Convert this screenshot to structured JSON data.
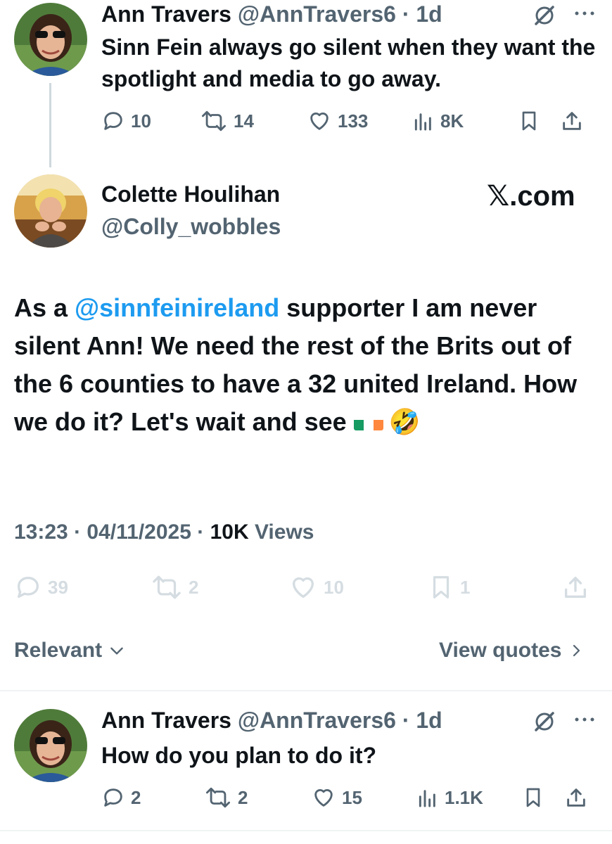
{
  "parent_tweet": {
    "author_name": "Ann Travers",
    "handle_time": "@AnnTravers6 · 1d",
    "text": "Sinn Fein always go silent when they want the spotlight and media to go away.",
    "reply_count": "10",
    "retweet_count": "14",
    "like_count": "133",
    "view_count": "8K"
  },
  "main_tweet": {
    "author_name": "Colette Houlihan",
    "handle": "@Colly_wobbles",
    "watermark": "𝕏.com",
    "text_prefix": "As a ",
    "mention": "@sinnfeinireland",
    "text_rest": " supporter I am never silent Ann! We need the rest of the Brits out of the 6 counties to have a 32 united Ireland. How we do it? Let's wait and see ",
    "emoji": "🤣",
    "time": "13:23",
    "date": "04/11/2025",
    "views_count": "10K",
    "views_label": "Views",
    "reply_count": "39",
    "retweet_count": "2",
    "like_count": "10",
    "bookmark_count": "1"
  },
  "replies_header": {
    "filter_label": "Relevant",
    "quotes_label": "View quotes"
  },
  "reply_tweet": {
    "author_name": "Ann Travers",
    "handle_time": "@AnnTravers6 · 1d",
    "text": "How do you plan to do it?",
    "reply_count": "2",
    "retweet_count": "2",
    "like_count": "15",
    "view_count": "1.1K"
  },
  "colors": {
    "mention": "#1d9bf0",
    "secondary_text": "#536471",
    "faded_icon": "#d5dde2",
    "thread_line": "#cfd9de",
    "irish_flag": [
      "#169b62",
      "#ffffff",
      "#ff883e"
    ]
  },
  "icons": [
    "reply-icon",
    "retweet-icon",
    "like-icon",
    "views-icon",
    "bookmark-icon",
    "share-icon",
    "grok-icon",
    "more-icon",
    "chevron-down-icon",
    "chevron-right-icon",
    "irish-flag-emoji"
  ]
}
